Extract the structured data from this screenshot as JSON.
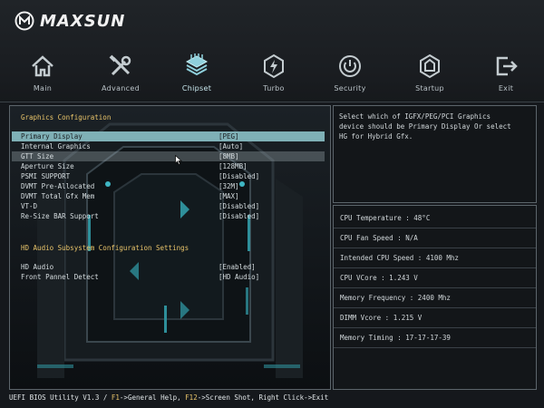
{
  "brand": {
    "name": "MAXSUN"
  },
  "nav": {
    "items": [
      {
        "label": "Main",
        "icon": "home-icon"
      },
      {
        "label": "Advanced",
        "icon": "tools-icon"
      },
      {
        "label": "Chipset",
        "icon": "chip-icon",
        "active": true
      },
      {
        "label": "Turbo",
        "icon": "bolt-icon"
      },
      {
        "label": "Security",
        "icon": "power-icon"
      },
      {
        "label": "Startup",
        "icon": "startup-icon"
      },
      {
        "label": "Exit",
        "icon": "exit-icon"
      }
    ]
  },
  "main": {
    "section1": "Graphics Configuration",
    "section2": "HD Audio Subsystem Configuration Settings",
    "graphics_settings": [
      {
        "label": "Primary Display",
        "value": "[PEG]",
        "selected": true
      },
      {
        "label": "Internal Graphics",
        "value": "[Auto]"
      },
      {
        "label": "GTT Size",
        "value": "[8MB]",
        "hover": true
      },
      {
        "label": "Aperture Size",
        "value": "[128MB]"
      },
      {
        "label": "PSMI SUPPORT",
        "value": "[Disabled]"
      },
      {
        "label": "DVMT Pre-Allocated",
        "value": "[32M]"
      },
      {
        "label": "DVMT Total Gfx Mem",
        "value": "[MAX]"
      },
      {
        "label": "VT-D",
        "value": "[Disabled]"
      },
      {
        "label": "Re-Size BAR Support",
        "value": "[Disabled]"
      }
    ],
    "audio_settings": [
      {
        "label": "HD Audio",
        "value": "[Enabled]"
      },
      {
        "label": "Front Pannel Detect",
        "value": "[HD Audio]"
      }
    ]
  },
  "help": {
    "text": "Select which of IGFX/PEG/PCI Graphics\ndevice should be Primary Display Or select\nHG for Hybrid Gfx."
  },
  "monitor": {
    "rows": [
      "CPU Temperature : 48°C",
      "CPU Fan Speed : N/A",
      "Intended CPU Speed : 4100 Mhz",
      "CPU VCore : 1.243 V",
      "Memory Frequency : 2400 Mhz",
      "DIMM Vcore : 1.215 V",
      "Memory Timing : 17-17-17-39"
    ]
  },
  "footer": {
    "prefix": "UEFI BIOS Utility V1.3 / ",
    "key1": "F1",
    "text1": "->General Help, ",
    "key2": "F12",
    "text2": "->Screen Shot, Right Click->Exit"
  },
  "colors": {
    "accent_teal": "#7fb0b6",
    "section_title": "#e9c46a",
    "border": "#5c656b"
  }
}
